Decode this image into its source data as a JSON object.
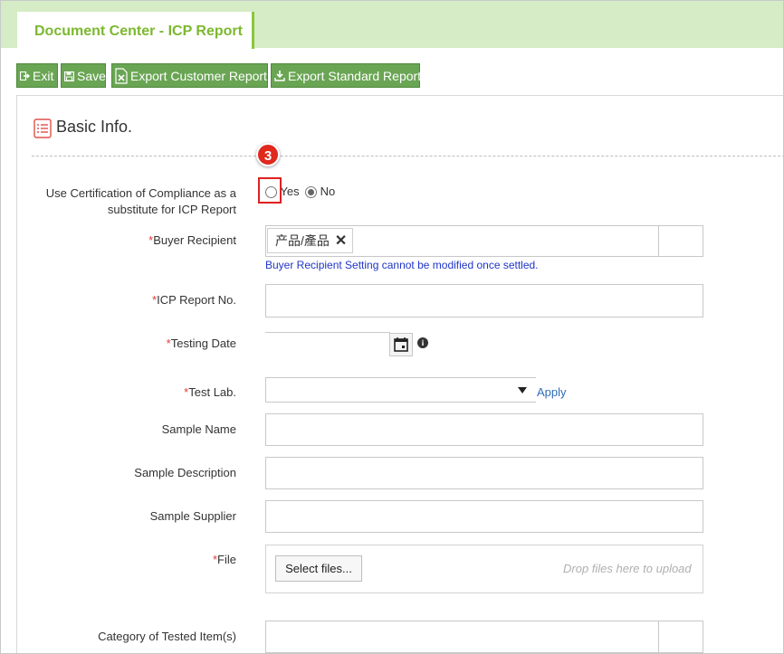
{
  "tab": {
    "title": "Document Center - ICP Report"
  },
  "toolbar": {
    "exit": "Exit",
    "save": "Save",
    "export_customer": "Export Customer Report",
    "export_standard": "Export Standard Report"
  },
  "section": {
    "title": "Basic Info."
  },
  "annotation": {
    "step": "3"
  },
  "form": {
    "coc": {
      "label_line1": "Use Certification of Compliance as a",
      "label_line2": "substitute for ICP Report",
      "yes": "Yes",
      "no": "No",
      "selected": "No"
    },
    "buyer": {
      "label": "Buyer Recipient",
      "tag": "产品/產品",
      "remove": "✕",
      "note": "Buyer Recipient Setting cannot be modified once settled."
    },
    "icp_no": {
      "label": "ICP Report No.",
      "value": ""
    },
    "testing_date": {
      "label": "Testing Date",
      "value": ""
    },
    "test_lab": {
      "label": "Test Lab.",
      "value": "",
      "apply": "Apply"
    },
    "sample_name": {
      "label": "Sample Name",
      "value": ""
    },
    "sample_desc": {
      "label": "Sample Description",
      "value": ""
    },
    "sample_supplier": {
      "label": "Sample Supplier",
      "value": ""
    },
    "file": {
      "label": "File",
      "select": "Select files...",
      "hint": "Drop files here to upload"
    },
    "category": {
      "label": "Category of Tested Item(s)",
      "value": ""
    }
  },
  "required_mark": "*",
  "colors": {
    "accent": "#7cb82f",
    "button": "#6aa554",
    "required": "#e53935",
    "note": "#1f35c9",
    "link": "#2f6db5"
  }
}
